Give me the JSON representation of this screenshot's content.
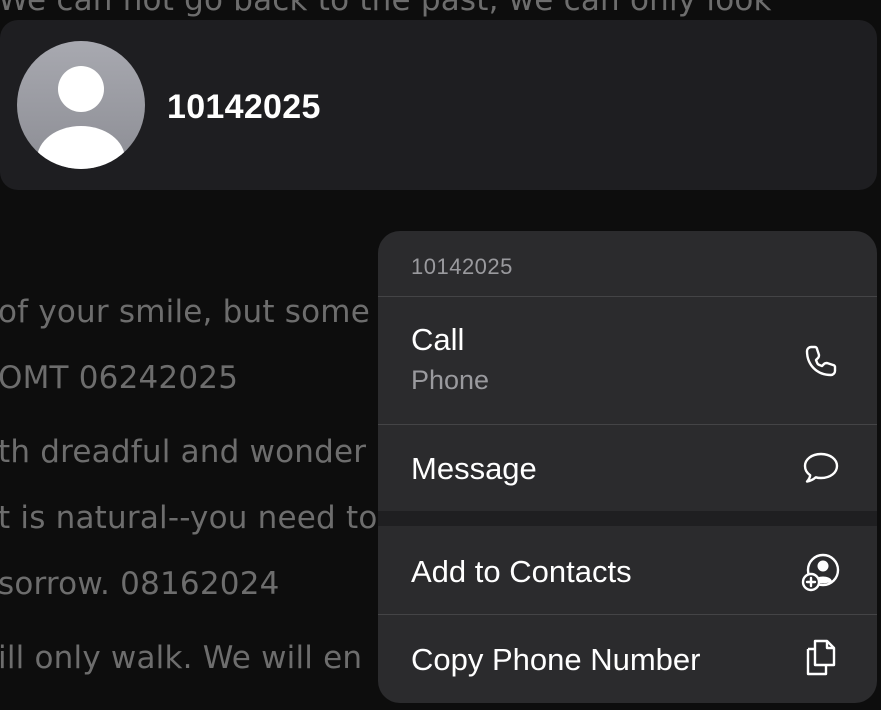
{
  "background": {
    "top_line": "We can not go back to the past, we can only look",
    "lines": [
      "of your smile, but some",
      "OMT 06242025",
      "th dreadful and wonder",
      "t is natural--you need to",
      "sorrow. 08162024",
      "ill only walk. We will en"
    ]
  },
  "contact": {
    "title": "10142025",
    "avatar": "person-silhouette-icon"
  },
  "menu": {
    "header": "10142025",
    "items": [
      {
        "label": "Call",
        "sublabel": "Phone",
        "icon": "phone-icon"
      },
      {
        "label": "Message",
        "icon": "message-bubble-icon"
      },
      {
        "label": "Add to Contacts",
        "icon": "add-contact-icon"
      },
      {
        "label": "Copy Phone Number",
        "icon": "copy-icon"
      }
    ]
  },
  "colors": {
    "background": "#0d0d0d",
    "card": "#1e1e21",
    "menu": "#2b2b2d",
    "text_primary": "#ffffff",
    "text_secondary": "#9a9a9e",
    "background_text": "#6d6d6d"
  }
}
